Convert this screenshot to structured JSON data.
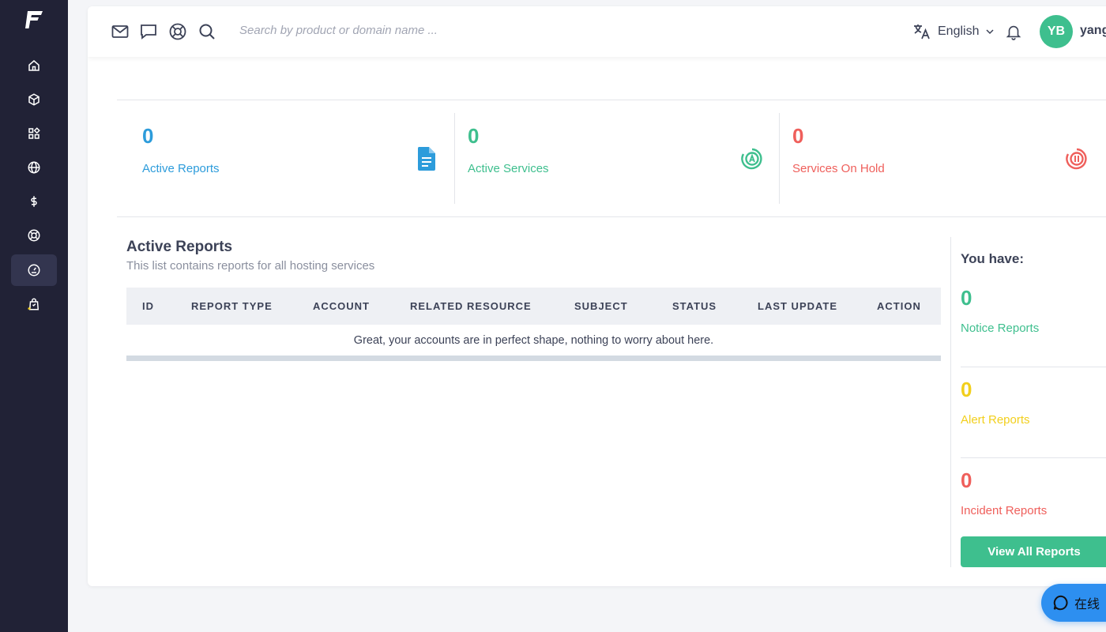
{
  "topbar": {
    "search_placeholder": "Search by product or domain name ...",
    "language": "English",
    "avatar_initials": "YB",
    "username": "yang"
  },
  "stats": [
    {
      "value": "0",
      "label": "Active Reports",
      "color": "#2d9cdb"
    },
    {
      "value": "0",
      "label": "Active Services",
      "color": "#3ebf8e"
    },
    {
      "value": "0",
      "label": "Services On Hold",
      "color": "#ef5f5b"
    }
  ],
  "reports": {
    "title": "Active Reports",
    "subtitle": "This list contains reports for all hosting services",
    "columns": [
      "ID",
      "REPORT TYPE",
      "ACCOUNT",
      "RELATED RESOURCE",
      "SUBJECT",
      "STATUS",
      "LAST UPDATE",
      "ACTION"
    ],
    "empty_message": "Great, your accounts are in perfect shape, nothing to worry about here."
  },
  "summary": {
    "title": "You have:",
    "items": [
      {
        "value": "0",
        "label": "Notice Reports",
        "color": "#3ebf8e"
      },
      {
        "value": "0",
        "label": "Alert Reports",
        "color": "#f2cf1c"
      },
      {
        "value": "0",
        "label": "Incident Reports",
        "color": "#ef5f5b"
      }
    ],
    "button_label": "View All Reports"
  },
  "chat": {
    "label": "在线"
  }
}
